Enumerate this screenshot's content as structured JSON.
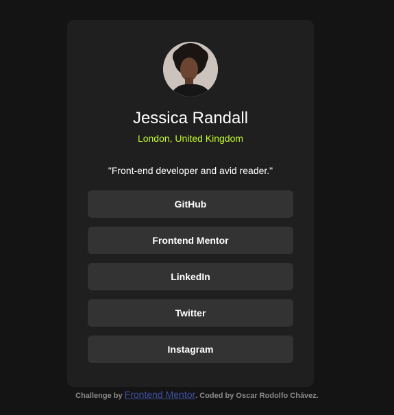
{
  "profile": {
    "name": "Jessica Randall",
    "location": "London, United Kingdom",
    "bio": "\"Front-end developer and avid reader.\""
  },
  "links": [
    {
      "label": "GitHub"
    },
    {
      "label": "Frontend Mentor"
    },
    {
      "label": "LinkedIn"
    },
    {
      "label": "Twitter"
    },
    {
      "label": "Instagram"
    }
  ],
  "attribution": {
    "prefix": "Challenge by",
    "link_label": "Frontend Mentor",
    "suffix": ". Coded by Oscar Rodolfo Chávez."
  },
  "colors": {
    "page_background": "#141414",
    "card_background": "#1f1f1f",
    "button_background": "#333333",
    "accent": "#c5f82a",
    "text": "#ffffff",
    "attribution_text": "#8a8a8a",
    "attribution_link": "#3e52a3"
  },
  "icons": {
    "avatar": "profile-photo"
  }
}
